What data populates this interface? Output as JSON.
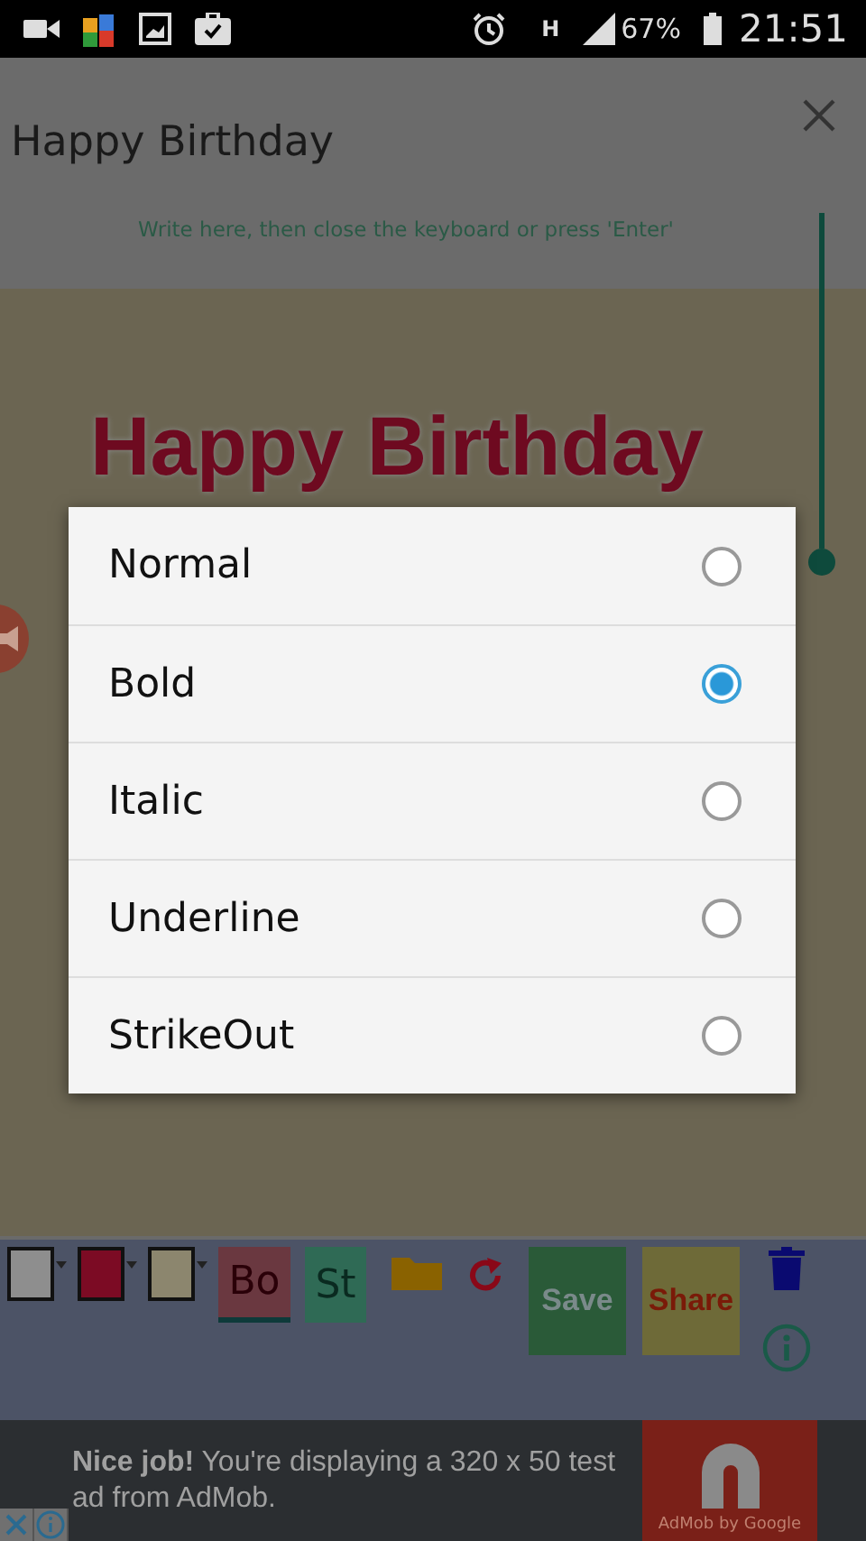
{
  "status_bar": {
    "network": "H",
    "battery": "67%",
    "time": "21:51"
  },
  "editor": {
    "title": "Happy Birthday",
    "hint": "Write here, then close the keyboard or press 'Enter'",
    "canvas_text": "Happy Birthday",
    "size_slider": {
      "level": 1
    }
  },
  "toolbar": {
    "swatches": [
      {
        "color": "#8e8e8e"
      },
      {
        "color": "#7c0b24"
      },
      {
        "color": "#8c866e"
      }
    ],
    "style_button": "Bo",
    "font_button": "St",
    "save": "Save",
    "share": "Share"
  },
  "dialog": {
    "options": [
      {
        "label": "Normal",
        "selected": false
      },
      {
        "label": "Bold",
        "selected": true
      },
      {
        "label": "Italic",
        "selected": false
      },
      {
        "label": "Underline",
        "selected": false
      },
      {
        "label": "StrikeOut",
        "selected": false
      }
    ]
  },
  "ad": {
    "text": "**Nice job!** You're displaying a 320 x 50 test ad from AdMob.",
    "logo_caption": "AdMob by Google"
  }
}
